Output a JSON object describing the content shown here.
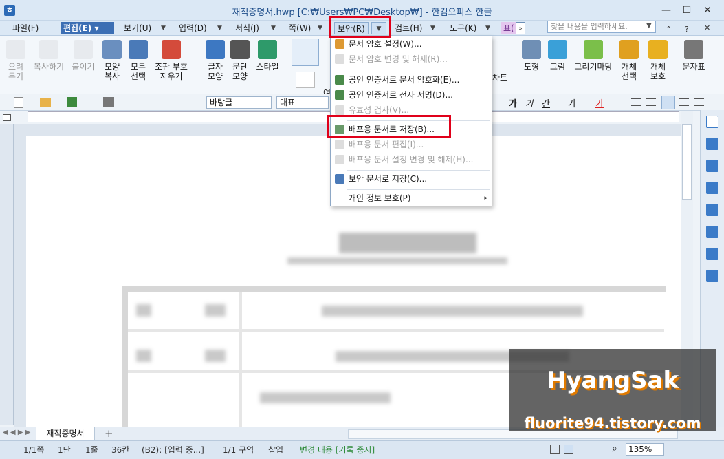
{
  "window": {
    "title": "재직증명서.hwp [C:₩Users₩PC₩Desktop₩] - 한컴오피스 한글",
    "app_icon": "ㅎ",
    "minimize": "—",
    "maximize": "☐",
    "close": "✕"
  },
  "menubar": {
    "items": [
      "파일(F)",
      "편집(E)",
      "보기(U)",
      "입력(D)",
      "서식(J)",
      "쪽(W)",
      "보안(R)",
      "검토(H)",
      "도구(K)",
      "표("
    ],
    "active": "편집(E)",
    "open": "보안(R)",
    "search_placeholder": "찾을 내용을 입력하세요."
  },
  "ribbon": {
    "buttons": [
      "오려\n두기",
      "복사하기",
      "붙이기",
      "모양\n복사",
      "모두\n선택",
      "조판 부호\n지우기",
      "글자\n모양",
      "문단\n모양",
      "스타일",
      "도형",
      "그림",
      "그리기마당",
      "개체\n선택",
      "개체\n보호",
      "문자표"
    ],
    "partial_labels": [
      "차트",
      "여"
    ]
  },
  "toolbar2": {
    "style_combo": "바탕글",
    "font_combo": "대표"
  },
  "security_menu": {
    "items": [
      {
        "label": "문서 암호 설정(W)...",
        "enabled": true
      },
      {
        "label": "문서 암호 변경 및 해제(R)...",
        "enabled": false
      },
      {
        "label": "공인 인증서로 문서 암호화(E)...",
        "enabled": true
      },
      {
        "label": "공인 인증서로 전자 서명(D)...",
        "enabled": true
      },
      {
        "label": "유효성 검사(V)...",
        "enabled": false
      },
      {
        "label": "배포용 문서로 저장(B)...",
        "enabled": true,
        "highlighted": true
      },
      {
        "label": "배포용 문서 편집(I)...",
        "enabled": false
      },
      {
        "label": "배포용 문서 설정 변경 및 해제(H)...",
        "enabled": false
      },
      {
        "label": "보안 문서로 저장(C)...",
        "enabled": true
      },
      {
        "label": "개인 정보 보호(P)",
        "enabled": true,
        "submenu": true
      }
    ]
  },
  "document_tab": "재직증명서",
  "status": {
    "page": "1/1쪽",
    "column": "1단",
    "line": "1줄",
    "char": "36칸",
    "cell": "(B2): [입력 중...]",
    "section": "1/1 구역",
    "mode": "삽입",
    "track": "변경 내용 [기록 중지]",
    "zoom": "135%"
  },
  "watermark": {
    "name": "HyangSak",
    "url": "fluorite94.tistory.com"
  },
  "colors": {
    "accent": "#3c6fb4",
    "highlight_box": "#e0001a",
    "status_green": "#2e8b3a"
  }
}
